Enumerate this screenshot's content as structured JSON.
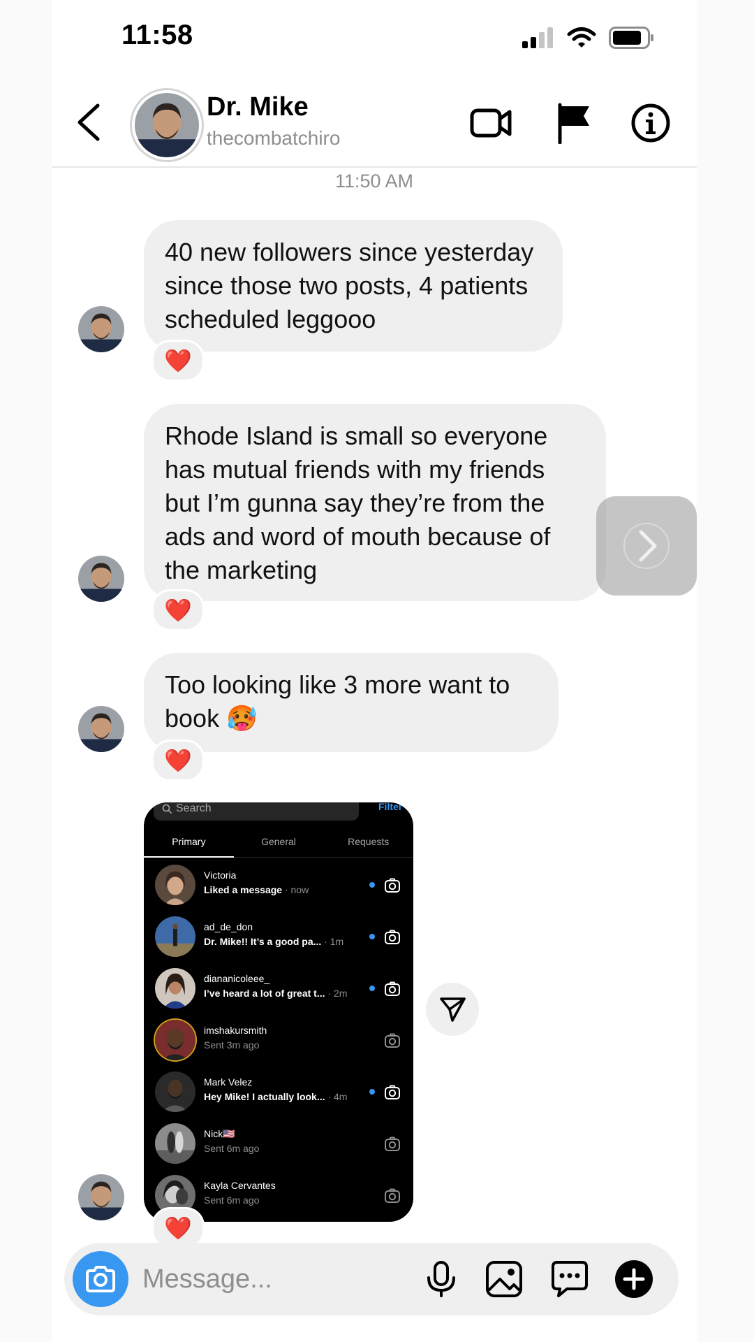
{
  "status_bar": {
    "time": "11:58"
  },
  "header": {
    "name": "Dr. Mike",
    "handle": "thecombatchiro"
  },
  "thread": {
    "timestamp": "11:50 AM",
    "messages": [
      {
        "text": "40 new followers since yesterday since those two posts, 4 patients scheduled leggooo",
        "reaction": "❤️"
      },
      {
        "text": "Rhode Island is small so everyone has mutual friends with my friends but I’m gunna say they’re from the ads and word of mouth because of the marketing",
        "reaction": "❤️"
      },
      {
        "text": "Too looking like 3 more want to book 🥵",
        "reaction": "❤️"
      }
    ],
    "shared_screenshot": {
      "search_placeholder": "Search",
      "filter_label": "Filter",
      "tabs": [
        "Primary",
        "General",
        "Requests"
      ],
      "rows": [
        {
          "name": "Victoria",
          "preview": "Liked a message",
          "time": "· now"
        },
        {
          "name": "ad_de_don",
          "preview": "Dr. Mike!! It’s a good pa...",
          "time": "· 1m"
        },
        {
          "name": "diananicoleee_",
          "preview": "I’ve heard a lot of great t...",
          "time": "· 2m"
        },
        {
          "name": "imshakursmith",
          "preview": "Sent 3m ago",
          "time": ""
        },
        {
          "name": "Mark Velez",
          "preview": "Hey Mike! I actually look...",
          "time": "· 4m"
        },
        {
          "name": "Nick🇺🇸",
          "preview": "Sent 6m ago",
          "time": ""
        },
        {
          "name": "Kayla Cervantes",
          "preview": "Sent 6m ago",
          "time": ""
        }
      ],
      "reaction": "❤️"
    }
  },
  "composer": {
    "placeholder": "Message..."
  },
  "colors": {
    "accent_blue": "#3897f0",
    "bubble_gray": "#efefef",
    "muted_text": "#8e8e8e"
  },
  "icons": [
    "back-chevron-icon",
    "video-camera-icon",
    "flag-icon",
    "info-icon",
    "forward-chevron-icon",
    "share-send-icon",
    "camera-icon",
    "microphone-icon",
    "gallery-icon",
    "sticker-icon",
    "plus-icon"
  ]
}
